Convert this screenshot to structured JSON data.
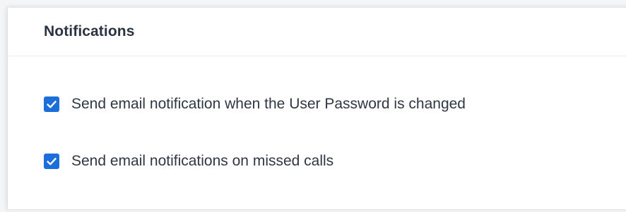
{
  "section": {
    "title": "Notifications"
  },
  "options": [
    {
      "label": "Send email notification when the User Password is changed",
      "checked": true,
      "icon": "check-icon"
    },
    {
      "label": "Send email notifications on missed calls",
      "checked": true,
      "icon": "check-icon"
    }
  ],
  "colors": {
    "checkbox_checked": "#1c6fdb",
    "title_text": "#2b3340",
    "label_text": "#2f3742"
  }
}
